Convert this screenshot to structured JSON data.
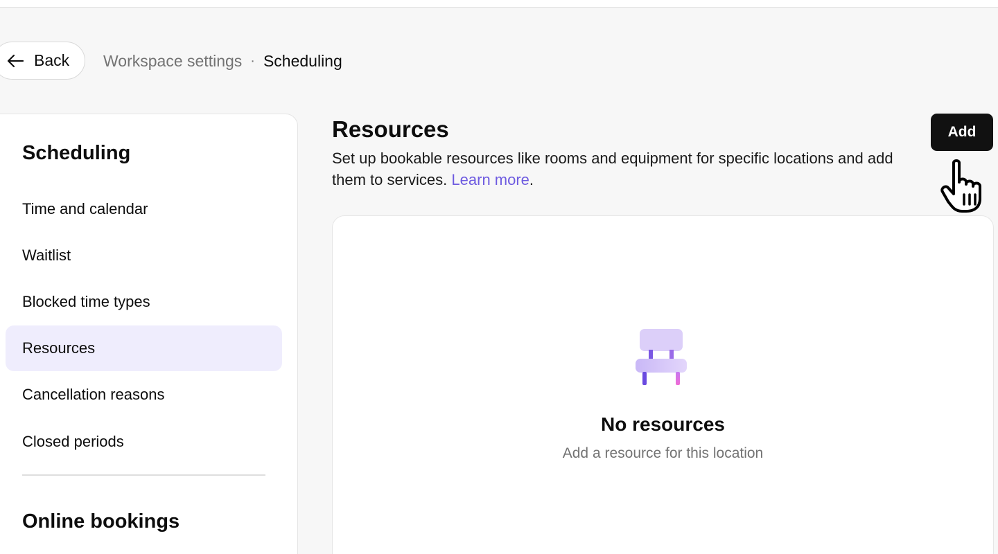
{
  "header": {
    "back_label": "Back",
    "breadcrumb_parent": "Workspace settings",
    "breadcrumb_separator": "·",
    "breadcrumb_current": "Scheduling"
  },
  "sidebar": {
    "section_title": "Scheduling",
    "items": [
      {
        "label": "Time and calendar",
        "active": false
      },
      {
        "label": "Waitlist",
        "active": false
      },
      {
        "label": "Blocked time types",
        "active": false
      },
      {
        "label": "Resources",
        "active": true
      },
      {
        "label": "Cancellation reasons",
        "active": false
      },
      {
        "label": "Closed periods",
        "active": false
      }
    ],
    "section2_title": "Online bookings"
  },
  "main": {
    "title": "Resources",
    "description": "Set up bookable resources like rooms and equipment for specific locations and add them to services.",
    "learn_more": "Learn more",
    "learn_more_suffix": ".",
    "add_label": "Add",
    "empty_title": "No resources",
    "empty_subtitle": "Add a resource for this location"
  },
  "icons": {
    "back": "arrow-left-icon",
    "empty": "chair-icon",
    "cursor": "hand-pointer-cursor"
  },
  "colors": {
    "accent": "#6e5be0",
    "active_nav_bg": "#efedfd",
    "primary_button": "#111111",
    "page_bg": "#f7f7f7"
  }
}
